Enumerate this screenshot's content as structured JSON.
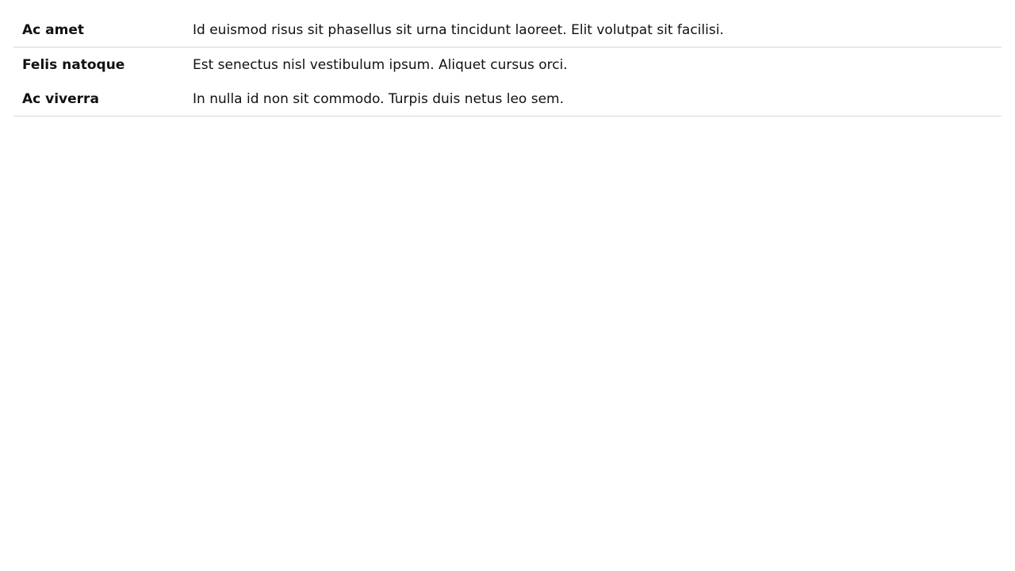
{
  "rows": [
    {
      "term": "Ac amet",
      "description": "Id euismod risus sit phasellus sit urna tincidunt laoreet. Elit volutpat sit facilisi."
    },
    {
      "term": "Felis natoque",
      "description": "Est senectus nisl vestibulum ipsum. Aliquet cursus orci."
    },
    {
      "term": "Ac viverra",
      "description": "In nulla id non sit commodo. Turpis duis netus leo sem."
    }
  ]
}
